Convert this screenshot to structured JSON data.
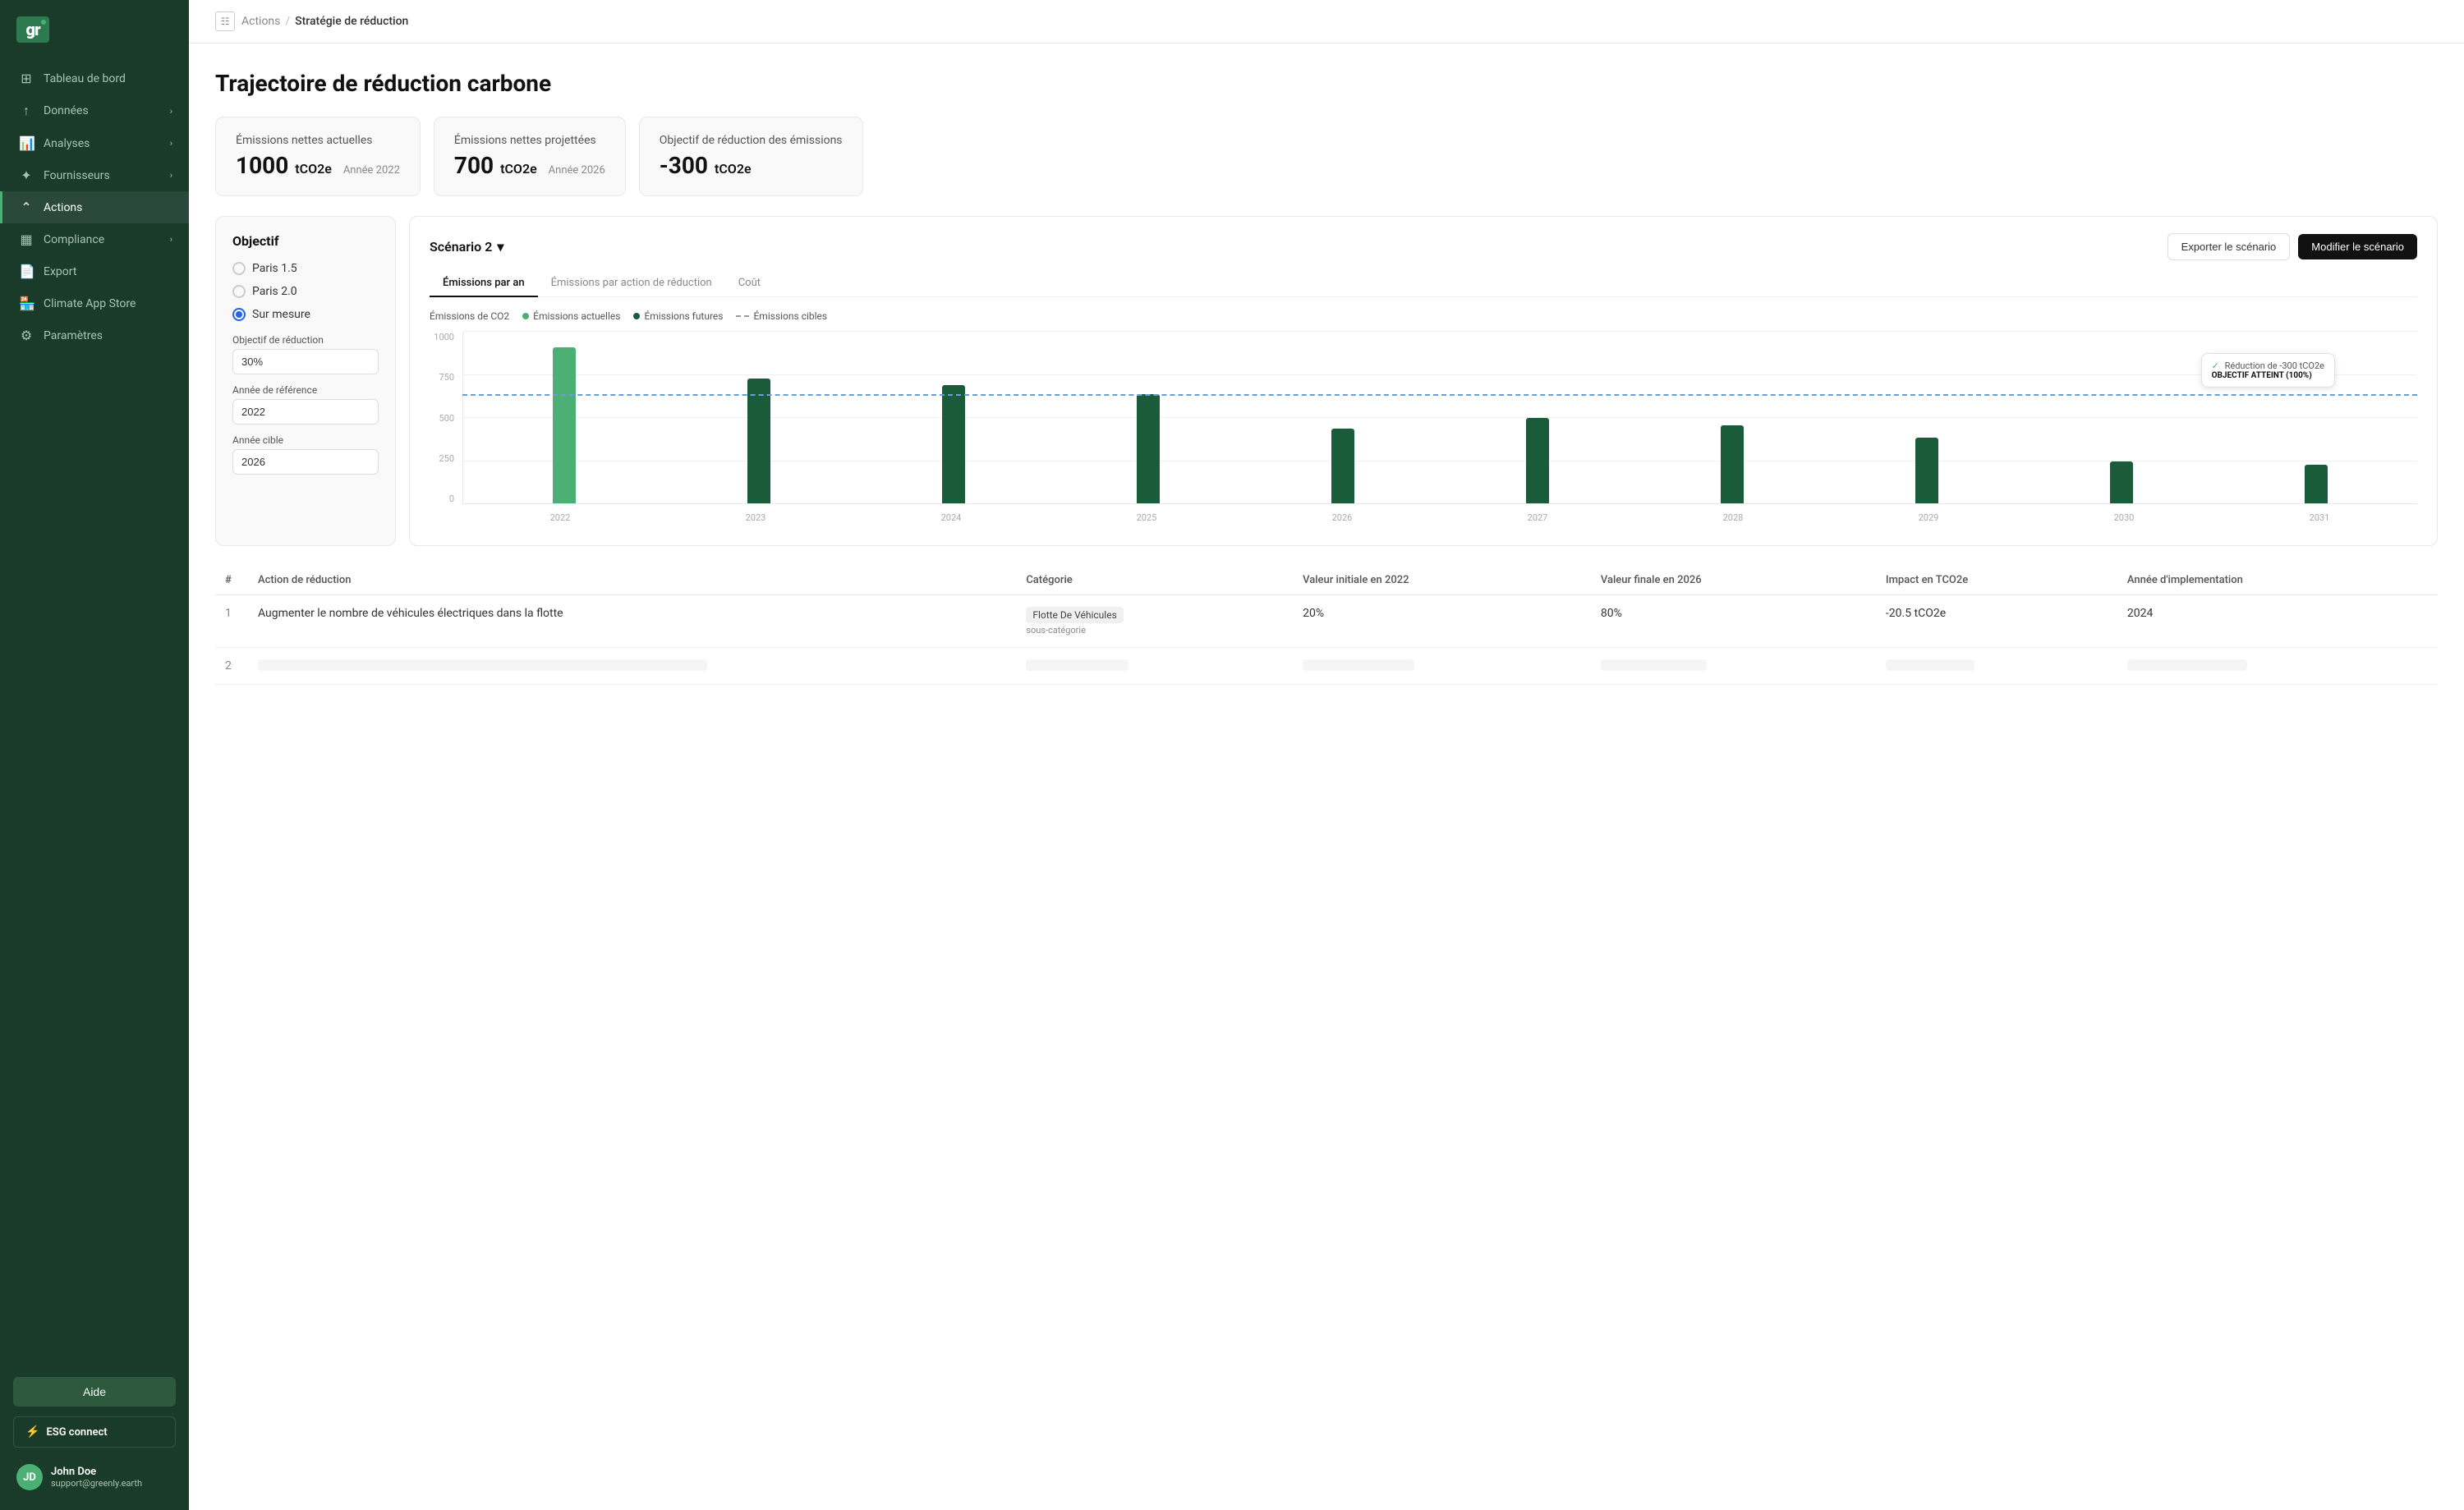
{
  "sidebar": {
    "logo_text": "gr",
    "nav_items": [
      {
        "id": "tableau",
        "label": "Tableau de bord",
        "icon": "⊞",
        "active": false,
        "has_chevron": false
      },
      {
        "id": "donnees",
        "label": "Données",
        "icon": "↑",
        "active": false,
        "has_chevron": true
      },
      {
        "id": "analyses",
        "label": "Analyses",
        "icon": "📊",
        "active": false,
        "has_chevron": true
      },
      {
        "id": "fournisseurs",
        "label": "Fournisseurs",
        "icon": "✦",
        "active": false,
        "has_chevron": true
      },
      {
        "id": "actions",
        "label": "Actions",
        "icon": "⌃",
        "active": true,
        "has_chevron": false
      },
      {
        "id": "compliance",
        "label": "Compliance",
        "icon": "▦",
        "active": false,
        "has_chevron": true
      },
      {
        "id": "export",
        "label": "Export",
        "icon": "📄",
        "active": false,
        "has_chevron": false
      },
      {
        "id": "climate",
        "label": "Climate App Store",
        "icon": "🏪",
        "active": false,
        "has_chevron": false
      },
      {
        "id": "parametres",
        "label": "Paramètres",
        "icon": "⚙",
        "active": false,
        "has_chevron": false
      }
    ],
    "help_btn": "Aide",
    "esg_label": "ESG connect",
    "user": {
      "name": "John Doe",
      "email": "support@greenly.earth",
      "initials": "JD"
    }
  },
  "breadcrumb": {
    "parent": "Actions",
    "current": "Stratégie de réduction"
  },
  "page": {
    "title": "Trajectoire de réduction carbone"
  },
  "kpi": {
    "cards": [
      {
        "label": "Émissions nettes actuelles",
        "value": "1000",
        "unit": "tCO2e",
        "year_label": "Année 2022"
      },
      {
        "label": "Émissions nettes projettées",
        "value": "700",
        "unit": "tCO2e",
        "year_label": "Année 2026"
      },
      {
        "label": "Objectif de réduction des émissions",
        "value": "-300",
        "unit": "tCO2e",
        "year_label": ""
      }
    ]
  },
  "objectif": {
    "title": "Objectif",
    "options": [
      {
        "id": "paris15",
        "label": "Paris 1.5",
        "checked": false
      },
      {
        "id": "paris20",
        "label": "Paris 2.0",
        "checked": false
      },
      {
        "id": "sur_mesure",
        "label": "Sur mesure",
        "checked": true
      }
    ],
    "reduction_label": "Objectif de réduction",
    "reduction_value": "30%",
    "reference_label": "Année de référence",
    "reference_value": "2022",
    "target_label": "Année cible",
    "target_value": "2026"
  },
  "scenario": {
    "selector_label": "Scénario 2",
    "export_btn": "Exporter le scénario",
    "modify_btn": "Modifier le scénario",
    "tabs": [
      {
        "id": "emissions_par_an",
        "label": "Émissions par an",
        "active": true
      },
      {
        "id": "emissions_par_action",
        "label": "Émissions par action de réduction",
        "active": false
      },
      {
        "id": "cout",
        "label": "Coût",
        "active": false
      }
    ],
    "chart_y_label": "Émissions de CO2",
    "legend": [
      {
        "id": "actual",
        "label": "Émissions actuelles",
        "type": "dot-green"
      },
      {
        "id": "future",
        "label": "Émissions futures",
        "type": "dot-dark"
      },
      {
        "id": "target",
        "label": "Émissions cibles",
        "type": "dashed"
      }
    ],
    "y_axis": [
      "1000",
      "750",
      "500",
      "250",
      "0"
    ],
    "bars": [
      {
        "year": "2022",
        "value": 1000,
        "type": "actual"
      },
      {
        "year": "2023",
        "value": 800,
        "type": "future"
      },
      {
        "year": "2024",
        "value": 760,
        "type": "future"
      },
      {
        "year": "2025",
        "value": 700,
        "type": "future"
      },
      {
        "year": "2026",
        "value": 480,
        "type": "future"
      },
      {
        "year": "2027",
        "value": 550,
        "type": "future"
      },
      {
        "year": "2028",
        "value": 500,
        "type": "future"
      },
      {
        "year": "2029",
        "value": 420,
        "type": "future"
      },
      {
        "year": "2030",
        "value": 270,
        "type": "future"
      },
      {
        "year": "2031",
        "value": 250,
        "type": "future"
      }
    ],
    "target_line_pct": 68,
    "tooltip": {
      "reduction": "Réduction de -300 tCO2e",
      "badge": "OBJECTIF ATTEINT (100%)"
    }
  },
  "table": {
    "headers": [
      "#",
      "Action de réduction",
      "Catégorie",
      "Valeur initiale en 2022",
      "Valeur finale en 2026",
      "Impact en TCO2e",
      "Année d'implementation"
    ],
    "rows": [
      {
        "num": "1",
        "action": "Augmenter le nombre de véhicules électriques dans la flotte",
        "category": "Flotte De Véhicules",
        "subcategory": "sous-catégorie",
        "initial_value": "20%",
        "final_value": "80%",
        "impact": "-20.5 tCO2e",
        "year": "2024"
      },
      {
        "num": "2",
        "action": "",
        "category": "",
        "subcategory": "",
        "initial_value": "",
        "final_value": "",
        "impact": "",
        "year": ""
      }
    ]
  }
}
